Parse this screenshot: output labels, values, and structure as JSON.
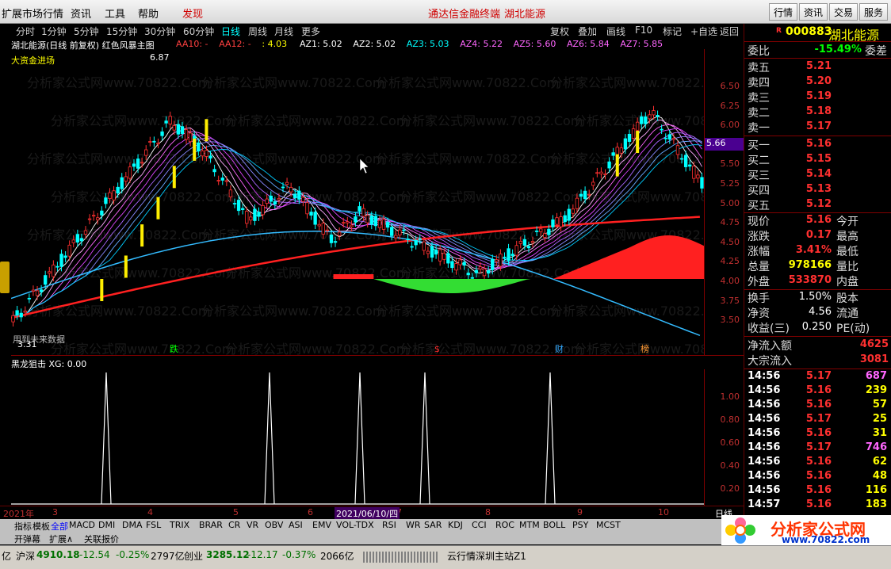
{
  "menubar": {
    "items": [
      "扩展市场行情",
      "资讯",
      "工具",
      "帮助"
    ],
    "discover": "发现",
    "center_title": "通达信金融终端",
    "center_stock": "湖北能源",
    "buttons": [
      "行情",
      "资讯",
      "交易",
      "服务"
    ]
  },
  "periods": [
    "分时",
    "1分钟",
    "5分钟",
    "15分钟",
    "30分钟",
    "60分钟",
    "日线",
    "周线",
    "月线",
    "更多"
  ],
  "active_period": "日线",
  "toolbar": [
    "复权",
    "叠加",
    "画线",
    "F10",
    "标记",
    "+自选",
    "返回"
  ],
  "chart_title": "湖北能源(日线 前复权) 红色风暴主图",
  "ma_labels": [
    {
      "t": "AA10: -",
      "c": "#ff4040"
    },
    {
      "t": "AA12: -",
      "c": "#ff4040"
    },
    {
      "t": ": 4.03",
      "c": "#ffff00"
    },
    {
      "t": "AZ1: 5.02",
      "c": "#ffffff"
    },
    {
      "t": "AZ2: 5.02",
      "c": "#ffffff"
    },
    {
      "t": "AZ3: 5.03",
      "c": "#00ffff"
    },
    {
      "t": "AZ4: 5.22",
      "c": "#ff66ff"
    },
    {
      "t": "AZ5: 5.60",
      "c": "#ff66ff"
    },
    {
      "t": "AZ6: 5.84",
      "c": "#ff66ff"
    },
    {
      "t": "AZ7: 5.85",
      "c": "#ff66ff"
    }
  ],
  "big_money_label": "大资金进场",
  "peak_label": "6.87",
  "low_label": "3.31",
  "future_data_label": "用到未来数据",
  "markers": [
    {
      "t": "跌",
      "c": "#00ff00"
    },
    {
      "t": "$",
      "c": "#ff3030"
    },
    {
      "t": "财",
      "c": "#33aaff"
    },
    {
      "t": "榜",
      "c": "#ff9933"
    }
  ],
  "price_axis": [
    "6.50",
    "6.25",
    "6.00",
    "5.75",
    "5.50",
    "5.25",
    "5.00",
    "4.75",
    "4.50",
    "4.25",
    "4.00",
    "3.75",
    "3.50"
  ],
  "current_price_tag": "5.66",
  "sub_title": "黑龙狙击 XG: 0.00",
  "sub_axis": [
    "1.00",
    "0.80",
    "0.60",
    "0.40",
    "0.20"
  ],
  "time_axis": {
    "year": "2021年",
    "months": [
      "3",
      "4",
      "5",
      "6",
      "7",
      "8",
      "9",
      "10"
    ],
    "cursor_date": "2021/06/10/四",
    "period": "日线"
  },
  "indicator_tabs": [
    "指标",
    "模板",
    "全部",
    "MACD",
    "DMI",
    "DMA",
    "FSL",
    "TRIX",
    "BRAR",
    "CR",
    "VR",
    "OBV",
    "ASI",
    "EMV",
    "VOL-TDX",
    "RSI",
    "WR",
    "SAR",
    "KDJ",
    "CCI",
    "ROC",
    "MTM",
    "BOLL",
    "PSY",
    "MCST"
  ],
  "indicator_tabs2": [
    "开弹幕",
    "扩展∧",
    "关联报价"
  ],
  "statusbar": {
    "prefix": "亿",
    "sh_name": "沪深",
    "sh_val": "4910.18",
    "sh_chg": "-12.54",
    "sh_pct": "-0.25%",
    "sh_amt": "2797亿",
    "cy_name": "创业",
    "cy_val": "3285.12",
    "cy_chg": "-12.17",
    "cy_pct": "-0.37%",
    "cy_amt": "2066亿",
    "server": "云行情深圳主站Z1"
  },
  "quote": {
    "code": "000883",
    "name": "湖北能源",
    "r_badge": "R",
    "wb_label": "委比",
    "wb_val": "-15.49%",
    "wc_label": "委差",
    "asks": [
      {
        "l": "卖五",
        "p": "5.21"
      },
      {
        "l": "卖四",
        "p": "5.20"
      },
      {
        "l": "卖三",
        "p": "5.19"
      },
      {
        "l": "卖二",
        "p": "5.18"
      },
      {
        "l": "卖一",
        "p": "5.17"
      }
    ],
    "bids": [
      {
        "l": "买一",
        "p": "5.16"
      },
      {
        "l": "买二",
        "p": "5.15"
      },
      {
        "l": "买三",
        "p": "5.14"
      },
      {
        "l": "买四",
        "p": "5.13"
      },
      {
        "l": "买五",
        "p": "5.12"
      }
    ],
    "stats": [
      {
        "l": "现价",
        "v": "5.16",
        "c": "#ff3030",
        "r": "今开"
      },
      {
        "l": "涨跌",
        "v": "0.17",
        "c": "#ff3030",
        "r": "最高"
      },
      {
        "l": "涨幅",
        "v": "3.41%",
        "c": "#ff3030",
        "r": "最低"
      },
      {
        "l": "总量",
        "v": "978166",
        "c": "#ffff00",
        "r": "量比"
      },
      {
        "l": "外盘",
        "v": "533870",
        "c": "#ff3030",
        "r": "内盘"
      }
    ],
    "stats2": [
      {
        "l": "换手",
        "v": "1.50%",
        "r": "股本"
      },
      {
        "l": "净资",
        "v": "4.56",
        "r": "流通"
      },
      {
        "l": "收益(三)",
        "v": "0.250",
        "r": "PE(动)"
      }
    ],
    "flow": [
      {
        "l": "净流入额",
        "v": "4625"
      },
      {
        "l": "大宗流入",
        "v": "3081"
      }
    ],
    "ticks": [
      {
        "t": "14:56",
        "p": "5.17",
        "v": "687",
        "vc": "#ff66ff"
      },
      {
        "t": "14:56",
        "p": "5.16",
        "v": "239",
        "vc": "#ffff00"
      },
      {
        "t": "14:56",
        "p": "5.16",
        "v": "57",
        "vc": "#ffff00"
      },
      {
        "t": "14:56",
        "p": "5.17",
        "v": "25",
        "vc": "#ffff00"
      },
      {
        "t": "14:56",
        "p": "5.16",
        "v": "31",
        "vc": "#ffff00"
      },
      {
        "t": "14:56",
        "p": "5.17",
        "v": "746",
        "vc": "#ff66ff"
      },
      {
        "t": "14:56",
        "p": "5.16",
        "v": "62",
        "vc": "#ffff00"
      },
      {
        "t": "14:56",
        "p": "5.16",
        "v": "48",
        "vc": "#ffff00"
      },
      {
        "t": "14:56",
        "p": "5.16",
        "v": "116",
        "vc": "#ffff00"
      },
      {
        "t": "14:57",
        "p": "5.16",
        "v": "183",
        "vc": "#ffff00"
      }
    ]
  },
  "logo": {
    "text": "分析家公式网",
    "url": "www.70822.com"
  },
  "watermark": "分析家公式网www.70822.Com"
}
